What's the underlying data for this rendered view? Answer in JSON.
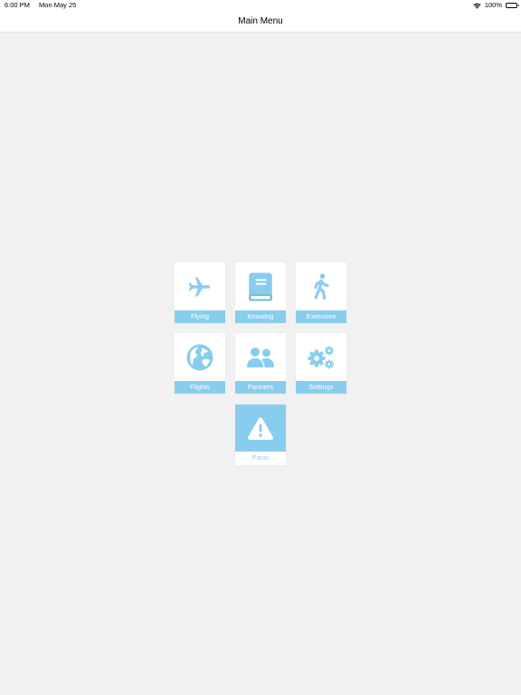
{
  "status_bar": {
    "time": "6:00 PM",
    "date": "Mon May 25",
    "battery": "100%"
  },
  "nav": {
    "title": "Main Menu"
  },
  "menu": {
    "items": [
      {
        "label": "Flying",
        "icon": "airplane-icon"
      },
      {
        "label": "Knowing",
        "icon": "book-icon"
      },
      {
        "label": "Exercises",
        "icon": "walking-person-icon"
      },
      {
        "label": "Flights",
        "icon": "globe-icon"
      },
      {
        "label": "Partners",
        "icon": "people-icon"
      },
      {
        "label": "Settings",
        "icon": "gears-icon"
      },
      {
        "label": "Panic",
        "icon": "warning-icon"
      }
    ]
  },
  "colors": {
    "accent": "#89cdee",
    "background": "#f1f1f1",
    "tile": "#ffffff"
  }
}
